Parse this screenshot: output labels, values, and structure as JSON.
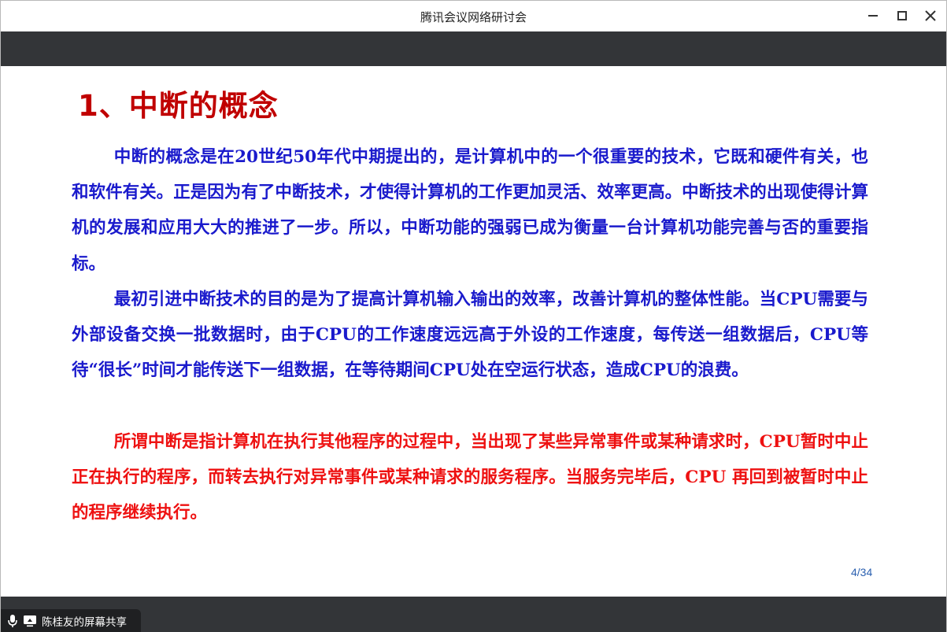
{
  "window": {
    "title": "腾讯会议网络研讨会"
  },
  "slide": {
    "title": "1、中断的概念",
    "paragraphs": [
      {
        "text": "中断的概念是在20世纪50年代中期提出的，是计算机中的一个很重要的技术，它既和硬件有关，也和软件有关。正是因为有了中断技术，才使得计算机的工作更加灵活、效率更高。中断技术的出现使得计算机的发展和应用大大的推进了一步。所以，中断功能的强弱已成为衡量一台计算机功能完善与否的重要指标。",
        "color": "#1a1acc"
      },
      {
        "text": "最初引进中断技术的目的是为了提高计算机输入输出的效率，改善计算机的整体性能。当CPU需要与外部设备交换一批数据时，由于CPU的工作速度远远高于外设的工作速度，每传送一组数据后，CPU等待“很长”时间才能传送下一组数据，在等待期间CPU处在空运行状态，造成CPU的浪费。",
        "color": "#1a1acc"
      },
      {
        "text": "所谓中断是指计算机在执行其他程序的过程中，当出现了某些异常事件或某种请求时，CPU暂时中止正在执行的程序，而转去执行对异常事件或某种请求的服务程序。当服务完毕后，CPU 再回到被暂时中止的程序继续执行。",
        "color": "#ee1111"
      }
    ],
    "page_number": "4/34"
  },
  "share": {
    "label": "陈桂友的屏幕共享",
    "icons": [
      "microphone-icon",
      "screen-share-icon"
    ]
  },
  "colors": {
    "title_red": "#c00000",
    "text_blue": "#1a1acc",
    "text_red": "#ee1111",
    "dark_bar": "#333538"
  }
}
